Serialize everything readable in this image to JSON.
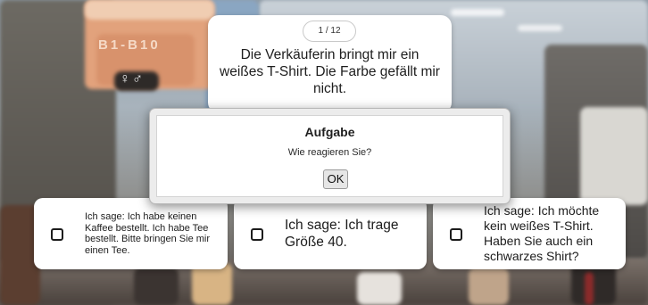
{
  "background": {
    "sign_text": "B1-B10",
    "restroom_sign": "🚹🚺"
  },
  "statement": {
    "counter": "1 / 12",
    "text": "Die Verkäuferin bringt mir ein weißes T-Shirt. Die Farbe gefällt mir nicht."
  },
  "modal": {
    "title": "Aufgabe",
    "question": "Wie reagieren Sie?",
    "ok_label": "OK"
  },
  "options": [
    {
      "text": "Ich sage: Ich habe keinen Kaffee bestellt. Ich habe Tee bestellt. Bitte bringen Sie mir einen Tee.",
      "checked": false
    },
    {
      "text": "Ich sage: Ich trage Größe 40.",
      "checked": false
    },
    {
      "text": "Ich sage: Ich möchte kein weißes T-Shirt. Haben Sie auch ein schwarzes Shirt?",
      "checked": false
    }
  ]
}
